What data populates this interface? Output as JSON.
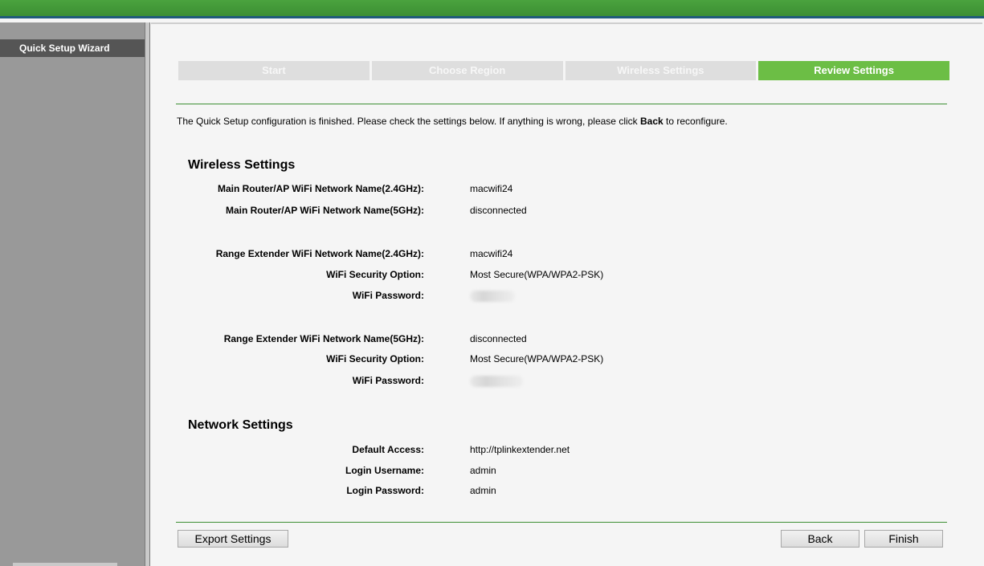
{
  "sidebar": {
    "items": [
      {
        "label": "Quick Setup Wizard"
      }
    ]
  },
  "steps": [
    {
      "label": "Start",
      "active": false
    },
    {
      "label": "Choose Region",
      "active": false
    },
    {
      "label": "Wireless Settings",
      "active": false
    },
    {
      "label": "Review Settings",
      "active": true
    }
  ],
  "intro": {
    "before": "The Quick Setup configuration is finished. Please check the settings below. If anything is wrong, please click ",
    "bold": "Back",
    "after": " to reconfigure."
  },
  "wireless": {
    "title": "Wireless Settings",
    "main_24_label": "Main Router/AP WiFi Network Name(2.4GHz):",
    "main_24_value": "macwifi24",
    "main_5_label": "Main Router/AP WiFi Network Name(5GHz):",
    "main_5_value": "disconnected",
    "ext_24_label": "Range Extender WiFi Network Name(2.4GHz):",
    "ext_24_value": "macwifi24",
    "ext_24_sec_label": "WiFi Security Option:",
    "ext_24_sec_value": "Most Secure(WPA/WPA2-PSK)",
    "ext_24_pwd_label": "WiFi Password:",
    "ext_5_label": "Range Extender WiFi Network Name(5GHz):",
    "ext_5_value": "disconnected",
    "ext_5_sec_label": "WiFi Security Option:",
    "ext_5_sec_value": "Most Secure(WPA/WPA2-PSK)",
    "ext_5_pwd_label": "WiFi Password:"
  },
  "network": {
    "title": "Network Settings",
    "access_label": "Default Access:",
    "access_value": "http://tplinkextender.net",
    "user_label": "Login Username:",
    "user_value": "admin",
    "pass_label": "Login Password:",
    "pass_value": "admin"
  },
  "buttons": {
    "export": "Export Settings",
    "back": "Back",
    "finish": "Finish"
  }
}
